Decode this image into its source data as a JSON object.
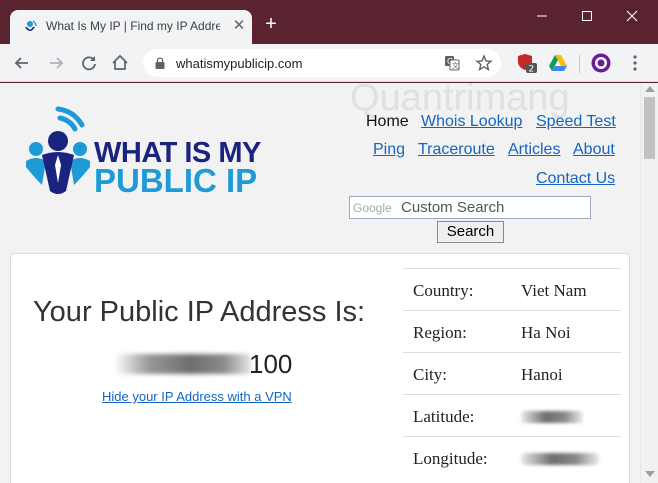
{
  "browser": {
    "tab_title": "What Is My IP | Find my IP Addre",
    "url": "whatismypublicip.com",
    "extension_badge": "2"
  },
  "site": {
    "logo_line1": "WHAT IS MY",
    "logo_line2": "PUBLIC IP",
    "watermark": "Quantrimang",
    "nav": {
      "home": "Home",
      "whois": "Whois Lookup",
      "speed": "Speed Test",
      "ping": "Ping",
      "traceroute": "Traceroute",
      "articles": "Articles",
      "about": "About",
      "contact": "Contact Us"
    },
    "search": {
      "brand": "Google",
      "placeholder": "Custom Search",
      "button": "Search"
    },
    "ip": {
      "heading": "Your Public IP Address Is:",
      "visible_suffix": "100",
      "vpn_link": "Hide your IP Address with a VPN"
    },
    "geo": [
      {
        "label": "Country:",
        "value": "Viet Nam"
      },
      {
        "label": "Region:",
        "value": "Ha Noi"
      },
      {
        "label": "City:",
        "value": "Hanoi"
      },
      {
        "label": "Latitude:",
        "value": ""
      },
      {
        "label": "Longitude:",
        "value": ""
      }
    ]
  },
  "colors": {
    "titlebar": "#5a2330",
    "logo_dark": "#1a237e",
    "logo_light": "#1e9ad6",
    "link": "#1565c0"
  }
}
